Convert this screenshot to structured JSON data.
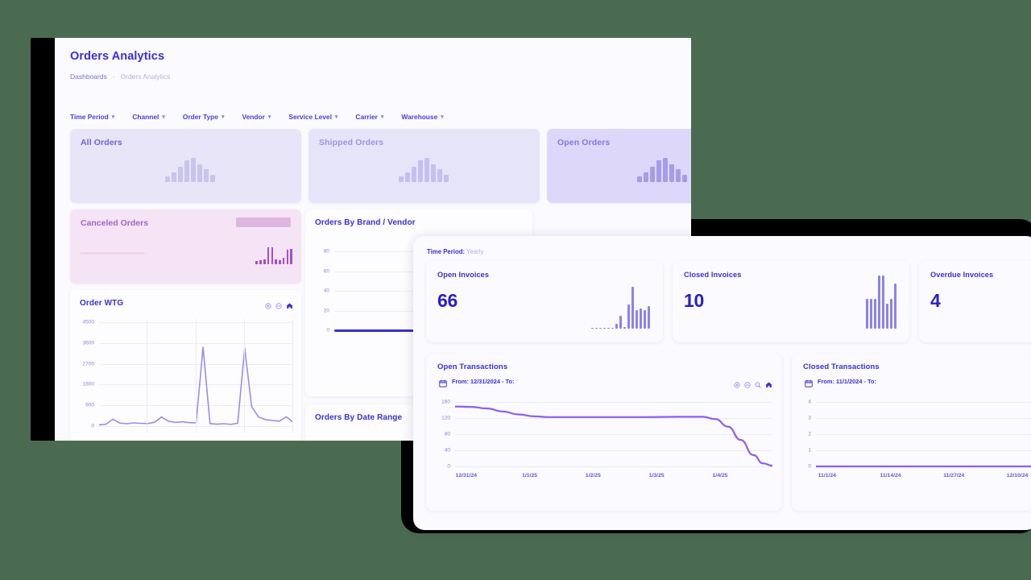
{
  "theme": {
    "desktop_bg": "#4a6b50",
    "accent": "#3b2fd0",
    "line_purple": "#8d6ee8",
    "pink": "#f5e4f5"
  },
  "back_window": {
    "page_title": "Orders Analytics",
    "breadcrumb": {
      "root": "Dashboards",
      "separator": "-",
      "current": "Orders Analytics"
    },
    "filters": [
      {
        "label": "Time Period",
        "caret": "▾"
      },
      {
        "label": "Channel",
        "caret": "▾"
      },
      {
        "label": "Order Type",
        "caret": "▾"
      },
      {
        "label": "Vendor",
        "caret": "▾"
      },
      {
        "label": "Service Level",
        "caret": "▾"
      },
      {
        "label": "Carrier",
        "caret": "▾"
      },
      {
        "label": "Warehouse",
        "caret": "▾"
      }
    ],
    "kpi_cards": [
      {
        "label": "All Orders",
        "variant": "all",
        "spark": [
          5,
          8,
          13,
          18,
          20,
          15,
          11,
          6
        ]
      },
      {
        "label": "Shipped Orders",
        "variant": "shipped",
        "spark": [
          5,
          8,
          13,
          18,
          20,
          15,
          11,
          6
        ]
      },
      {
        "label": "Open Orders",
        "variant": "open",
        "spark": [
          5,
          8,
          13,
          18,
          20,
          15,
          11,
          6
        ]
      }
    ],
    "canceled_card": {
      "label": "Canceled Orders",
      "spark": [
        3,
        4,
        5,
        16,
        16,
        5,
        4,
        6,
        14,
        15
      ]
    },
    "brand_chart": {
      "title": "Orders By Brand / Vendor"
    },
    "wtg_chart": {
      "title": "Order WTG",
      "icons": [
        "zoom-in-icon",
        "zoom-out-icon",
        "home-icon"
      ]
    },
    "daterange_chart": {
      "title": "Orders By Date Range"
    }
  },
  "front_window": {
    "time_period_label": "Time Period:",
    "time_period_value": "Yearly",
    "invoice_cards": [
      {
        "label": "Open Invoices",
        "value": "66",
        "spark": [
          1,
          1,
          1,
          1,
          1,
          1,
          5,
          14,
          2,
          26,
          45,
          20,
          22,
          20,
          24
        ]
      },
      {
        "label": "Closed Invoices",
        "value": "10",
        "spark": [
          22,
          22,
          22,
          39,
          39,
          18,
          22,
          33
        ]
      },
      {
        "label": "Overdue Invoices",
        "value": "4",
        "spark": []
      }
    ],
    "open_transactions": {
      "title": "Open Transactions",
      "date_text": "From: 12/31/2024 - To:",
      "calendar_icon": "calendar-icon",
      "icons": [
        "zoom-in-icon",
        "zoom-out-icon",
        "magnifier-icon",
        "home-icon"
      ]
    },
    "closed_transactions": {
      "title": "Closed Transactions",
      "date_text": "From: 11/1/2024 - To:",
      "calendar_icon": "calendar-icon"
    }
  },
  "chart_data": [
    {
      "id": "brand_vendor",
      "type": "bar",
      "title": "Orders By Brand / Vendor",
      "categories": [
        "",
        "",
        "",
        "",
        ""
      ],
      "values": [
        0,
        0,
        0,
        0,
        0
      ],
      "ytick_labels": [
        "80",
        "60",
        "40",
        "20",
        "0"
      ],
      "ylim": [
        0,
        90
      ],
      "xlabel": "",
      "ylabel": "",
      "grid": true,
      "legend": "none"
    },
    {
      "id": "order_wtg",
      "type": "line",
      "title": "Order WTG",
      "ytick_labels": [
        "4500",
        "3600",
        "2700",
        "1800",
        "900",
        "0"
      ],
      "ylim": [
        0,
        4500
      ],
      "values": [
        60,
        90,
        320,
        140,
        110,
        150,
        130,
        120,
        180,
        420,
        230,
        170,
        200,
        160,
        150,
        3650,
        120,
        90,
        110,
        80,
        130,
        3600,
        900,
        420,
        300,
        260,
        230,
        430,
        180
      ],
      "grid": true,
      "xlabel": "",
      "ylabel": ""
    },
    {
      "id": "orders_by_date_range",
      "type": "line",
      "title": "Orders By Date Range",
      "values": [],
      "grid": true
    },
    {
      "id": "open_invoices_spark",
      "type": "bar",
      "title": "Open Invoices",
      "values": [
        1,
        1,
        1,
        1,
        1,
        1,
        5,
        14,
        2,
        26,
        45,
        20,
        22,
        20,
        24
      ],
      "annotation": "66"
    },
    {
      "id": "closed_invoices_spark",
      "type": "bar",
      "title": "Closed Invoices",
      "values": [
        22,
        22,
        22,
        39,
        39,
        18,
        22,
        33
      ],
      "annotation": "10"
    },
    {
      "id": "open_transactions",
      "type": "line",
      "title": "Open Transactions",
      "ytick_labels": [
        "160",
        "120",
        "80",
        "40",
        "0"
      ],
      "xtick_labels": [
        "12/31/24",
        "1/1/25",
        "1/2/25",
        "1/3/25",
        "1/4/25"
      ],
      "ylim": [
        0,
        170
      ],
      "x": [
        0,
        5,
        10,
        15,
        20,
        25,
        30,
        40,
        50,
        60,
        70,
        78,
        82,
        86,
        90,
        94,
        97,
        100
      ],
      "values": [
        158,
        157,
        153,
        145,
        137,
        132,
        130,
        130,
        130,
        130,
        131,
        131,
        125,
        105,
        70,
        30,
        8,
        2
      ],
      "grid": true,
      "legend": "none"
    },
    {
      "id": "closed_transactions",
      "type": "line",
      "title": "Closed Transactions",
      "ytick_labels": [
        "4",
        "3",
        "2",
        "1",
        "0"
      ],
      "xtick_labels": [
        "11/1/24",
        "11/14/24",
        "11/27/24",
        "12/10/24"
      ],
      "ylim": [
        0,
        4
      ],
      "x": [
        0,
        25,
        50,
        75,
        100
      ],
      "values": [
        0,
        0,
        0,
        0,
        0
      ],
      "grid": true,
      "legend": "none"
    }
  ]
}
